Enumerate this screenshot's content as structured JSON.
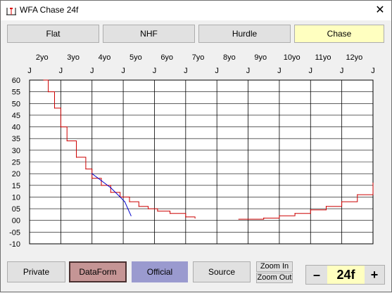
{
  "window": {
    "title": "WFA Chase 24f",
    "close_symbol": "✕"
  },
  "tabs": [
    {
      "label": "Flat"
    },
    {
      "label": "NHF"
    },
    {
      "label": "Hurdle"
    },
    {
      "label": "Chase",
      "selected": true
    }
  ],
  "bottom": {
    "private_label": "Private",
    "dataform_label": "DataForm",
    "official_label": "Official",
    "source_label": "Source",
    "zoom_in_label": "Zoom In",
    "zoom_out_label": "Zoom Out",
    "minus_label": "–",
    "plus_label": "+",
    "distance_value": "24f"
  },
  "colors": {
    "series_red": "#cc0000",
    "series_blue": "#0000cc",
    "chase_tab": "#ffffc0",
    "dataform": "#c59595",
    "official": "#9a9acf"
  },
  "chart_data": {
    "type": "line",
    "x_age_labels": [
      "2yo",
      "3yo",
      "4yo",
      "5yo",
      "6yo",
      "7yo",
      "8yo",
      "9yo",
      "10yo",
      "11yo",
      "12yo"
    ],
    "x_month_labels": [
      "J",
      "J",
      "J",
      "J",
      "J",
      "J",
      "J",
      "J",
      "J",
      "J",
      "J",
      "J"
    ],
    "ylim": [
      -10,
      60
    ],
    "y_ticks": [
      "60",
      "55",
      "50",
      "45",
      "40",
      "35",
      "30",
      "25",
      "20",
      "15",
      "10",
      "05",
      "00",
      "-05",
      "-10"
    ],
    "xlim": [
      0,
      11
    ],
    "grid": true,
    "series": [
      {
        "color": "red",
        "x": [
          0.45,
          0.6,
          0.8,
          1.0,
          1.2,
          1.5,
          1.8,
          2.0,
          2.3,
          2.6,
          2.9,
          3.2,
          3.5,
          3.8,
          4.1,
          4.5,
          5.0,
          5.3
        ],
        "y": [
          60,
          55,
          48,
          40,
          34,
          27,
          22,
          18,
          15,
          12,
          10,
          8,
          6,
          5,
          4,
          3,
          1.5,
          1
        ],
        "step_bumps": true
      },
      {
        "color": "red",
        "x": [
          6.7,
          7.0,
          7.5,
          8.0,
          8.5,
          9.0,
          9.5,
          10.0,
          10.5,
          11.0
        ],
        "y": [
          0.5,
          0.5,
          1,
          2,
          3,
          4.5,
          6,
          8,
          11,
          16
        ],
        "step_bumps": true
      },
      {
        "color": "blue",
        "x": [
          2.0,
          2.3,
          2.6,
          2.9,
          3.05,
          3.15,
          3.25
        ],
        "y": [
          20,
          17,
          14,
          10,
          8,
          5,
          2
        ]
      }
    ]
  }
}
